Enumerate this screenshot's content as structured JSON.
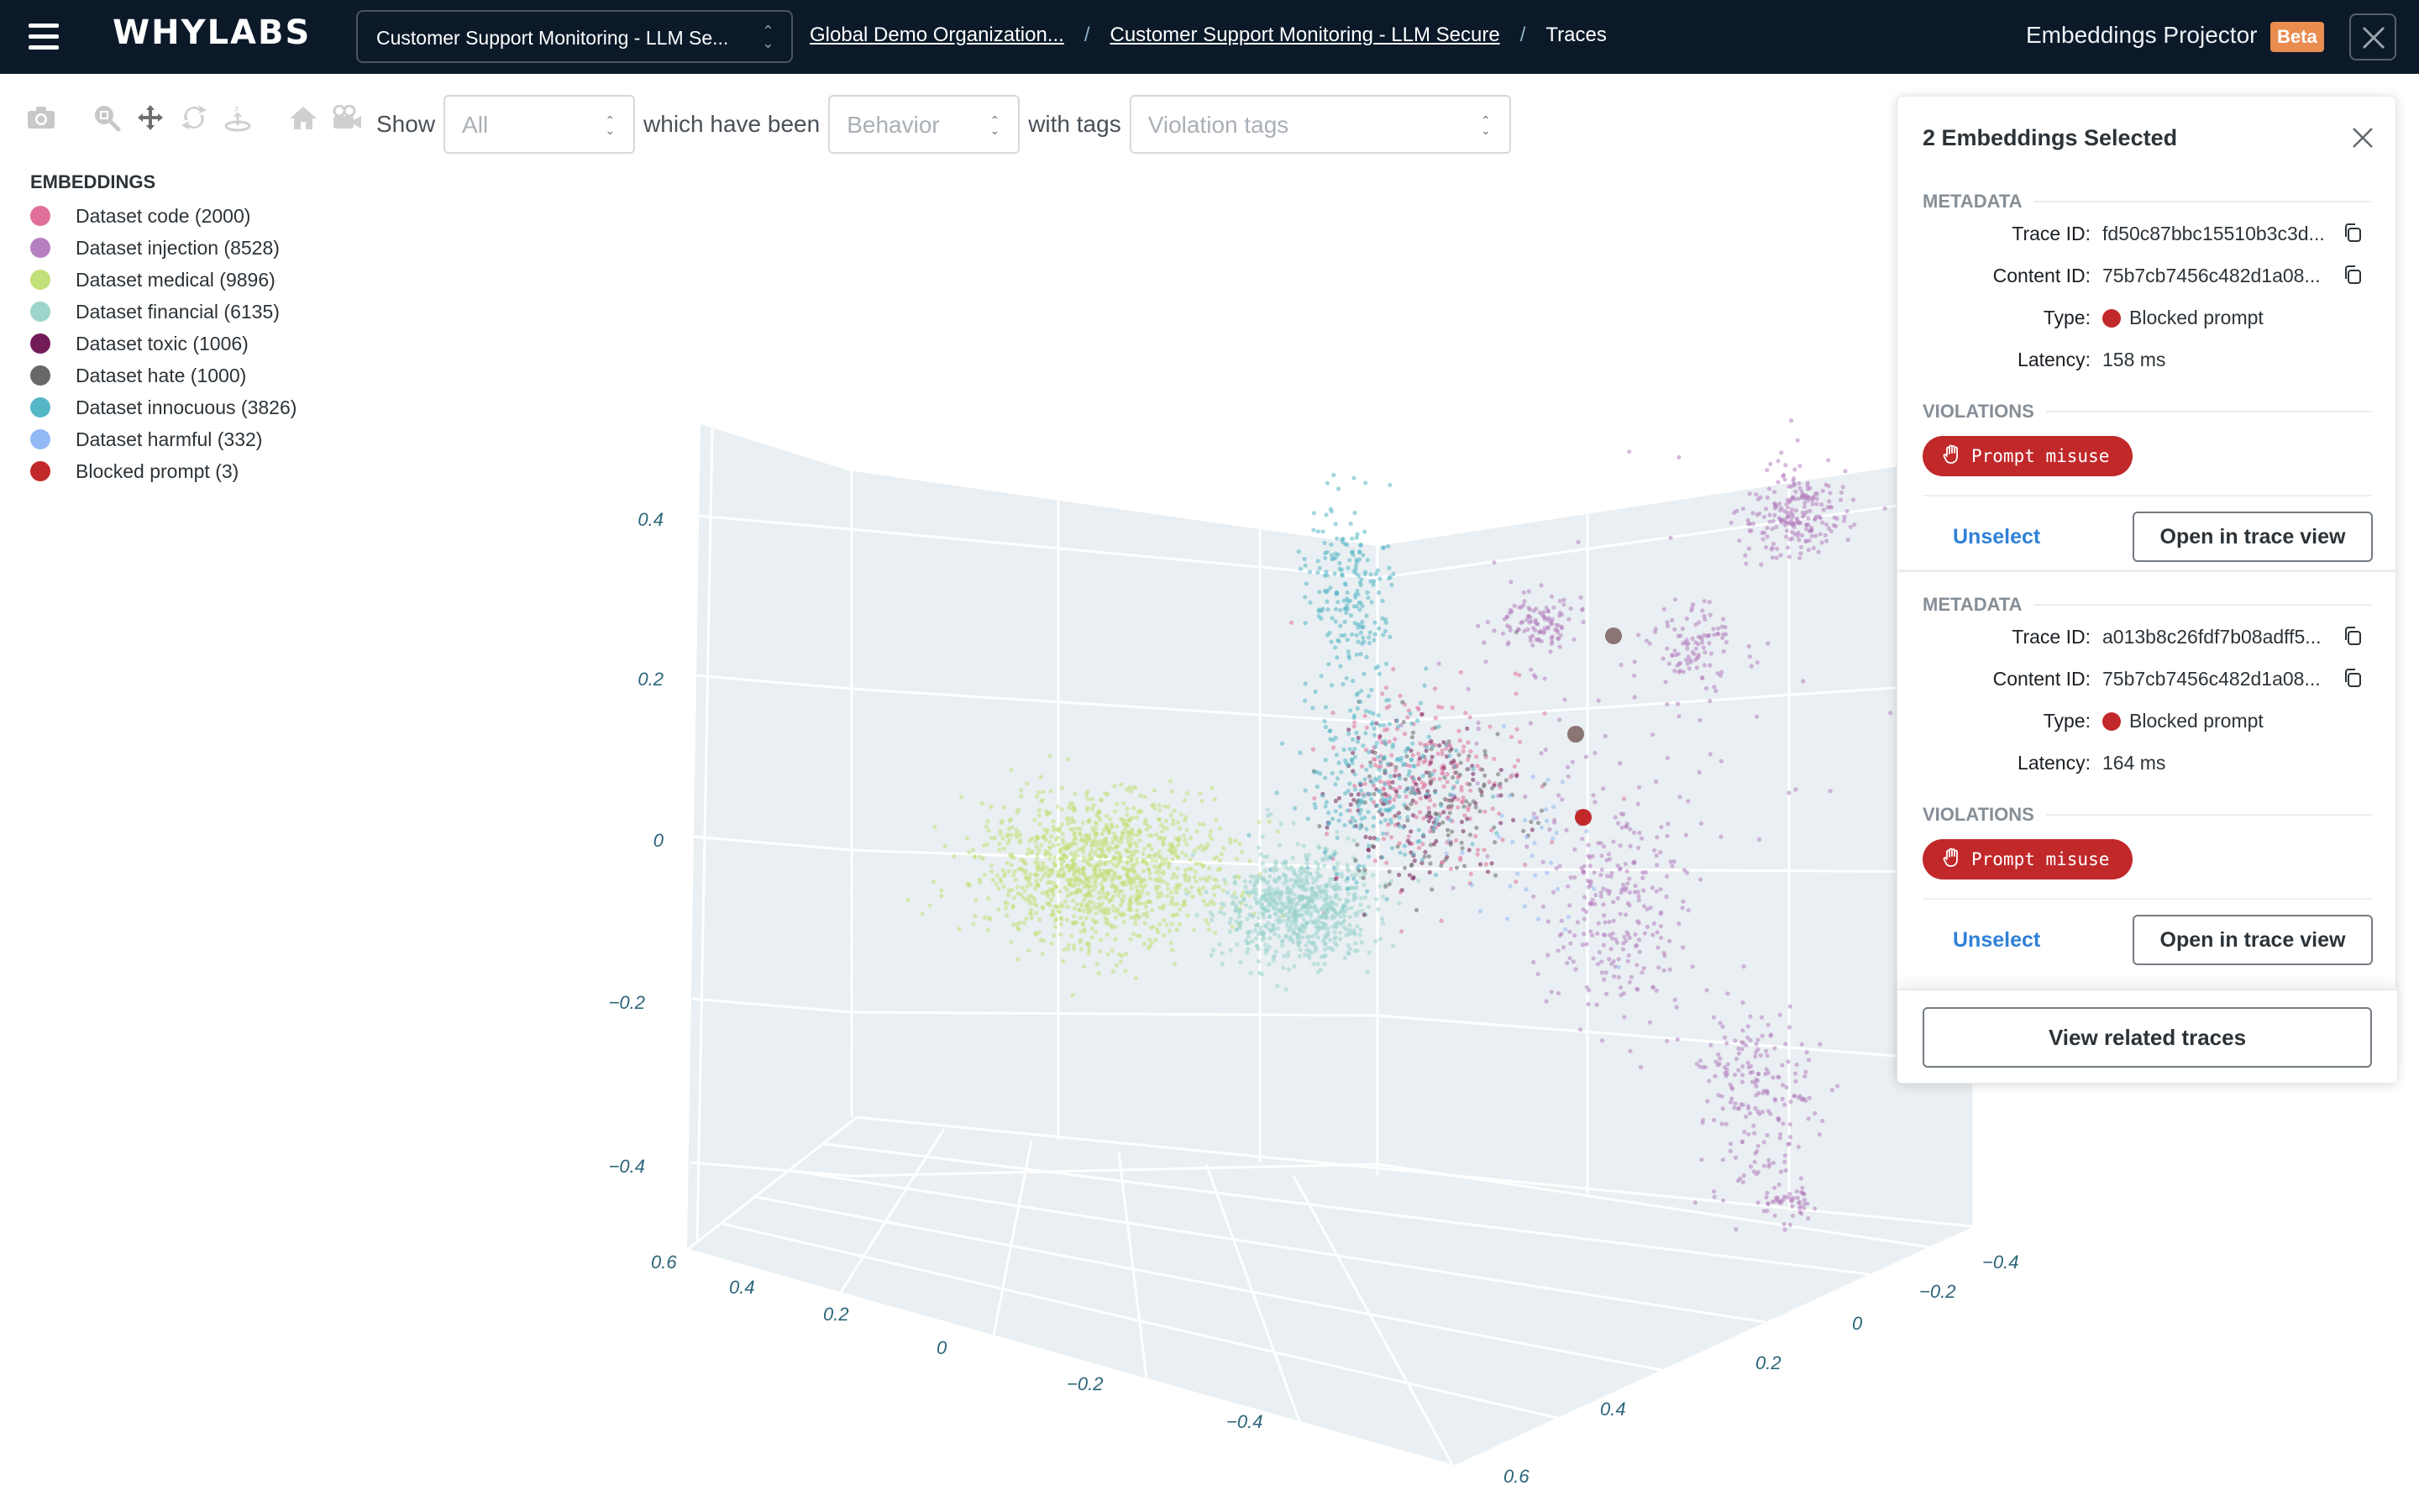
{
  "header": {
    "logo": "WHYLABS",
    "resource_select": "Customer Support Monitoring - LLM Se...",
    "breadcrumb": [
      {
        "label": "Global Demo Organization..."
      },
      {
        "label": "Customer Support Monitoring - LLM Secure"
      },
      {
        "label": "Traces"
      }
    ],
    "separator": "/",
    "title": "Embeddings Projector",
    "badge": "Beta"
  },
  "toolbar": {
    "icons": [
      "camera-icon",
      "zoom-icon",
      "pan-icon",
      "orbit-rotation-icon",
      "turntable-rotation-icon",
      "reset-camera-icon",
      "save-camera-icon"
    ]
  },
  "filters": {
    "show_label": "Show",
    "show_value": "All",
    "behavior_label": "which have been",
    "behavior_placeholder": "Behavior",
    "tags_label": "with tags",
    "tags_placeholder": "Violation tags"
  },
  "legend": {
    "title": "EMBEDDINGS",
    "items": [
      {
        "label": "Dataset code (2000)",
        "color": "#e0709a"
      },
      {
        "label": "Dataset injection (8528)",
        "color": "#b57fc0"
      },
      {
        "label": "Dataset medical (9896)",
        "color": "#c3e07a"
      },
      {
        "label": "Dataset financial (6135)",
        "color": "#9dd4cc"
      },
      {
        "label": "Dataset toxic (1006)",
        "color": "#741c57"
      },
      {
        "label": "Dataset hate (1000)",
        "color": "#686868"
      },
      {
        "label": "Dataset innocuous (3826)",
        "color": "#55b7c6"
      },
      {
        "label": "Dataset harmful (332)",
        "color": "#92b9f5"
      },
      {
        "label": "Blocked prompt (3)",
        "color": "#c1282a"
      }
    ]
  },
  "chart_data": {
    "type": "scatter",
    "dimensions": 3,
    "title": "",
    "axes": {
      "z": {
        "ticks": [
          "-0.4",
          "-0.2",
          "0",
          "0.2",
          "0.4"
        ],
        "range": [
          -0.5,
          0.5
        ]
      },
      "x": {
        "ticks": [
          "0.6",
          "0.4",
          "0.2",
          "0",
          "-0.2",
          "-0.4"
        ],
        "range": [
          -0.5,
          0.6
        ]
      },
      "y": {
        "ticks": [
          "0.6",
          "0.4",
          "0.2",
          "0",
          "-0.2",
          "-0.4"
        ],
        "range": [
          -0.5,
          0.6
        ]
      }
    },
    "grid": true,
    "legend_placement": "top-left",
    "series": [
      {
        "name": "Dataset code",
        "count": 2000,
        "color": "#e0709a"
      },
      {
        "name": "Dataset injection",
        "count": 8528,
        "color": "#b57fc0"
      },
      {
        "name": "Dataset medical",
        "count": 9896,
        "color": "#c3e07a"
      },
      {
        "name": "Dataset financial",
        "count": 6135,
        "color": "#9dd4cc"
      },
      {
        "name": "Dataset toxic",
        "count": 1006,
        "color": "#741c57"
      },
      {
        "name": "Dataset hate",
        "count": 1000,
        "color": "#686868"
      },
      {
        "name": "Dataset innocuous",
        "count": 3826,
        "color": "#55b7c6"
      },
      {
        "name": "Dataset harmful",
        "count": 332,
        "color": "#92b9f5"
      },
      {
        "name": "Blocked prompt",
        "count": 3,
        "color": "#c1282a"
      }
    ],
    "selected_points": 2
  },
  "panel": {
    "title": "2 Embeddings Selected",
    "selections": [
      {
        "metadata_label": "METADATA",
        "trace_id_label": "Trace ID:",
        "trace_id": "fd50c87bbc15510b3c3d...",
        "content_id_label": "Content ID:",
        "content_id": "75b7cb7456c482d1a08...",
        "type_label": "Type:",
        "type": "Blocked prompt",
        "latency_label": "Latency:",
        "latency": "158 ms",
        "violations_label": "VIOLATIONS",
        "violation": "Prompt misuse",
        "unselect": "Unselect",
        "open": "Open in trace view"
      },
      {
        "metadata_label": "METADATA",
        "trace_id_label": "Trace ID:",
        "trace_id": "a013b8c26fdf7b08adff5...",
        "content_id_label": "Content ID:",
        "content_id": "75b7cb7456c482d1a08...",
        "type_label": "Type:",
        "type": "Blocked prompt",
        "latency_label": "Latency:",
        "latency": "164 ms",
        "violations_label": "VIOLATIONS",
        "violation": "Prompt misuse",
        "unselect": "Unselect",
        "open": "Open in trace view"
      }
    ],
    "related": "View related traces"
  }
}
